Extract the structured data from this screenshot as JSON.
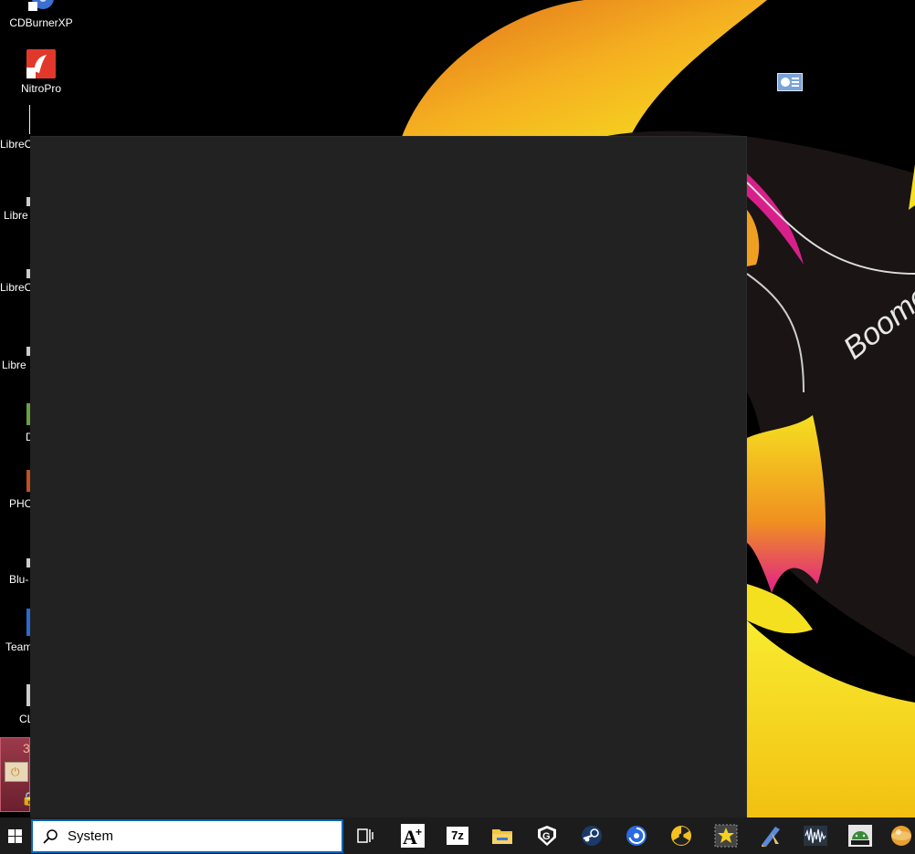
{
  "desktop": {
    "icons": [
      {
        "label": "CDBurnerXP",
        "icon": "cdburnerxp-icon"
      },
      {
        "label": "NitroPro",
        "icon": "nitropro-icon"
      },
      {
        "label": "LibreO",
        "icon": "libreoffice-writer-icon"
      },
      {
        "label": "Libre",
        "icon": "libreoffice-icon"
      },
      {
        "label": "LibreO",
        "icon": "libreoffice-icon"
      },
      {
        "label": "Libre",
        "icon": "libreoffice-icon"
      },
      {
        "label": "D",
        "icon": "app-icon"
      },
      {
        "label": "PHO",
        "icon": "app-icon"
      },
      {
        "label": "Blu-",
        "icon": "app-icon"
      },
      {
        "label": "Team",
        "icon": "teamviewer-icon"
      },
      {
        "label": "CL",
        "icon": "app-icon"
      }
    ],
    "wallpaper_text": "Boomerang",
    "widget_digit": "3"
  },
  "search": {
    "value": "System",
    "icon": "search-icon"
  },
  "taskbar": {
    "icons": [
      "task-view-icon",
      "font-tool-icon",
      "7zip-icon",
      "file-explorer-icon",
      "gigabyte-icon",
      "steam-icon",
      "uplay-icon",
      "radiation-app-icon",
      "star-app-icon",
      "pen-app-icon",
      "audio-wave-icon",
      "android-icon",
      "globe-icon"
    ],
    "sevenzip_label": "7z"
  },
  "colors": {
    "panel": "#222222",
    "taskbar": "#1c1c1c",
    "search_border": "#0a64b4",
    "wall_yellow": "#f5e020",
    "wall_orange": "#f08a1c",
    "wall_magenta": "#d8208a"
  }
}
